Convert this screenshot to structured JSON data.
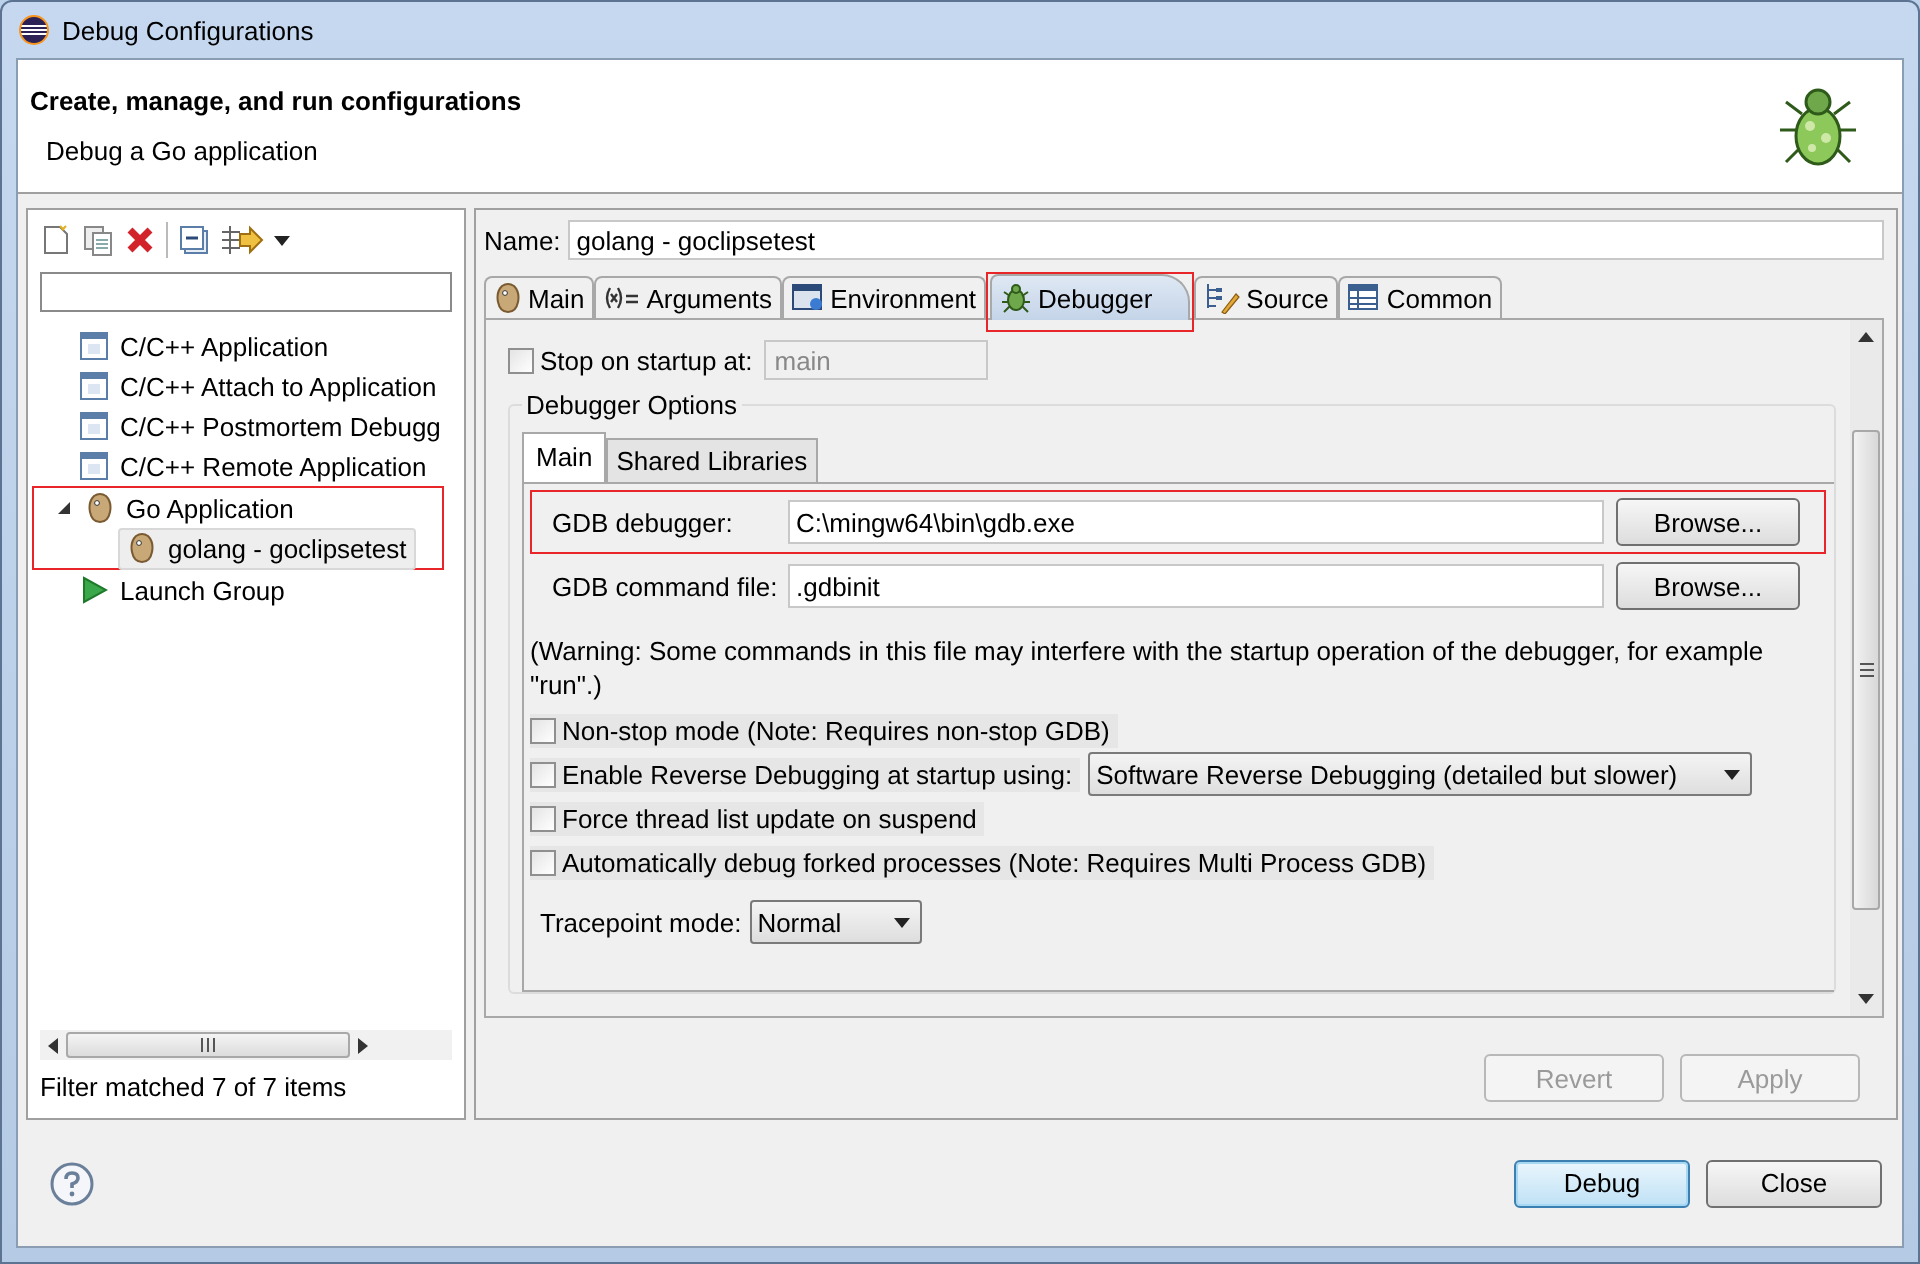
{
  "window": {
    "title": "Debug Configurations"
  },
  "header": {
    "title": "Create, manage, and run configurations",
    "subtitle": "Debug a Go application"
  },
  "sidebar": {
    "tree": [
      {
        "label": "C/C++ Application",
        "kind": "c",
        "selected": false,
        "highlighted": false
      },
      {
        "label": "C/C++ Attach to Application",
        "kind": "c",
        "selected": false,
        "highlighted": false
      },
      {
        "label": "C/C++ Postmortem Debugg",
        "kind": "c",
        "selected": false,
        "highlighted": false
      },
      {
        "label": "C/C++ Remote Application",
        "kind": "c",
        "selected": false,
        "highlighted": false
      },
      {
        "label": "Go Application",
        "kind": "gopher",
        "selected": false,
        "expanded": true,
        "highlighted": true,
        "children": [
          {
            "label": "golang - goclipsetest",
            "kind": "gopher",
            "selected": true
          }
        ]
      },
      {
        "label": "Launch Group",
        "kind": "launch",
        "selected": false,
        "highlighted": false
      }
    ],
    "status": "Filter matched 7 of 7 items"
  },
  "name_field": {
    "label": "Name:",
    "value": "golang - goclipsetest"
  },
  "tabs": [
    {
      "label": "Main",
      "kind": "gopher",
      "selected": false,
      "highlighted": false
    },
    {
      "label": "Arguments",
      "kind": "args",
      "selected": false,
      "highlighted": false
    },
    {
      "label": "Environment",
      "kind": "env",
      "selected": false,
      "highlighted": false
    },
    {
      "label": "Debugger",
      "kind": "bug",
      "selected": true,
      "highlighted": true
    },
    {
      "label": "Source",
      "kind": "source",
      "selected": false,
      "highlighted": false
    },
    {
      "label": "Common",
      "kind": "common",
      "selected": false,
      "highlighted": false
    }
  ],
  "debugger": {
    "stop_on_startup": {
      "label": "Stop on startup at:",
      "checked": false,
      "value": "main",
      "disabled": true
    },
    "group_title": "Debugger Options",
    "subtabs": [
      {
        "label": "Main",
        "selected": true
      },
      {
        "label": "Shared Libraries",
        "selected": false
      }
    ],
    "fields": [
      {
        "label": "GDB debugger:",
        "value": "C:\\mingw64\\bin\\gdb.exe",
        "button": "Browse...",
        "highlighted": true
      },
      {
        "label": "GDB command file:",
        "value": ".gdbinit",
        "button": "Browse...",
        "highlighted": false
      }
    ],
    "warning": "(Warning: Some commands in this file may interfere with the startup operation of the debugger, for example \"run\".)",
    "options": [
      {
        "kind": "checkbox",
        "label": "Non-stop mode (Note: Requires non-stop GDB)",
        "checked": false
      },
      {
        "kind": "checkbox-select",
        "label": "Enable Reverse Debugging at startup using:",
        "checked": false,
        "select": "Software Reverse Debugging (detailed but slower)"
      },
      {
        "kind": "checkbox",
        "label": "Force thread list update on suspend",
        "checked": false
      },
      {
        "kind": "checkbox",
        "label": "Automatically debug forked processes (Note: Requires Multi Process GDB)",
        "checked": false
      }
    ],
    "tracepoint": {
      "label": "Tracepoint mode:",
      "value": "Normal"
    }
  },
  "panel_buttons": [
    {
      "label": "Revert",
      "disabled": true
    },
    {
      "label": "Apply",
      "disabled": true
    }
  ],
  "dialog_buttons": [
    {
      "label": "Debug",
      "default": true
    },
    {
      "label": "Close",
      "default": false
    }
  ]
}
